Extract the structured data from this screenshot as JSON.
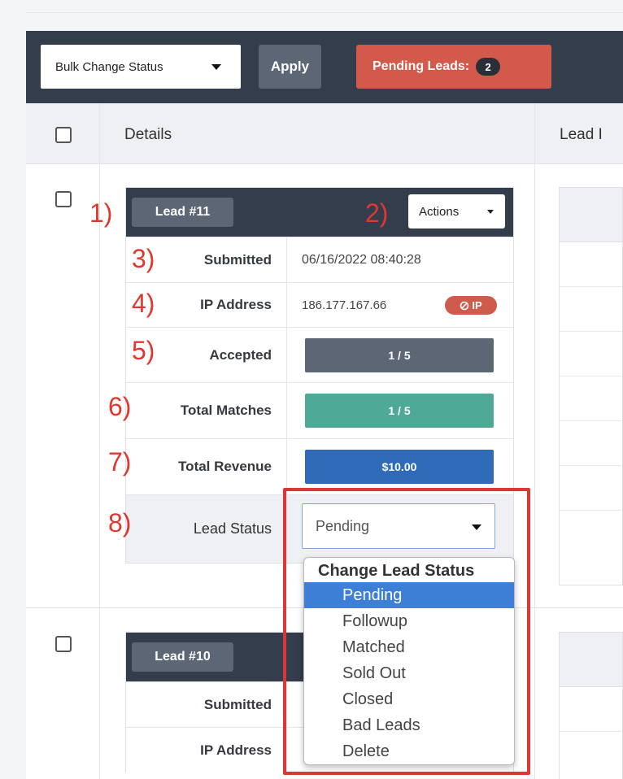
{
  "toolbar": {
    "bulk_select_value": "Bulk Change Status",
    "apply_label": "Apply",
    "pending_label": "Pending Leads:",
    "pending_count": "2"
  },
  "table": {
    "header_details": "Details",
    "header_lead": "Lead I"
  },
  "lead1": {
    "badge": "Lead #11",
    "actions_label": "Actions",
    "submitted_label": "Submitted",
    "submitted_value": "06/16/2022 08:40:28",
    "ip_label": "IP Address",
    "ip_value": "186.177.167.66",
    "ip_badge": "IP",
    "accepted_label": "Accepted",
    "accepted_value": "1 / 5",
    "matches_label": "Total Matches",
    "matches_value": "1 / 5",
    "revenue_label": "Total Revenue",
    "revenue_value": "$10.00",
    "status_label": "Lead Status",
    "status_value": "Pending"
  },
  "dropdown": {
    "header": "Change Lead Status",
    "options": [
      "Pending",
      "Followup",
      "Matched",
      "Sold Out",
      "Closed",
      "Bad Leads",
      "Delete"
    ],
    "selected_index": 0
  },
  "lead2": {
    "badge": "Lead #10",
    "submitted_label": "Submitted",
    "ip_label": "IP Address"
  },
  "callouts": [
    "1)",
    "2)",
    "3)",
    "4)",
    "5)",
    "6)",
    "7)",
    "8)"
  ],
  "colors": {
    "toolbar_bg": "#343d4b",
    "pending_red": "#d35a4b",
    "accepted_gray": "#5c6674",
    "matches_teal": "#4ea996",
    "revenue_blue": "#2f6bb8",
    "annotation_red": "#dc3737",
    "selected_blue": "#3d7fd6"
  }
}
